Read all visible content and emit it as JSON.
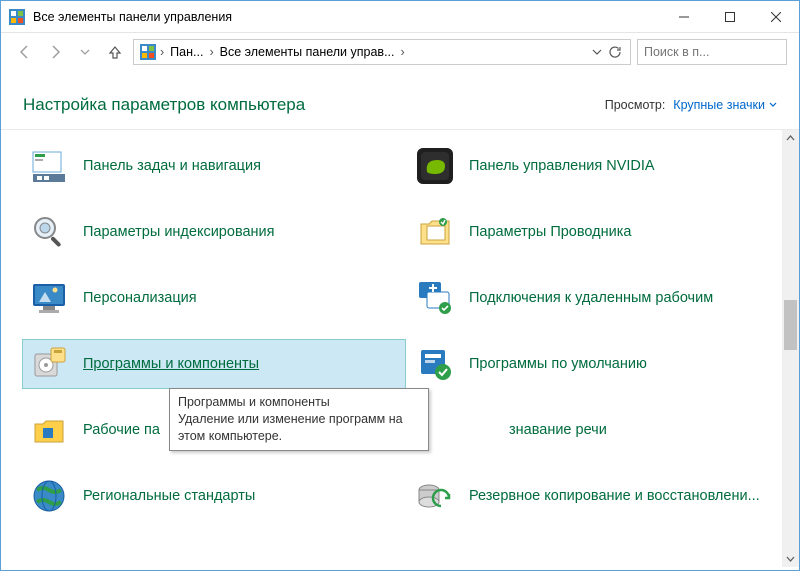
{
  "titlebar": {
    "title": "Все элементы панели управления"
  },
  "breadcrumb": {
    "seg1": "Пан...",
    "seg2": "Все элементы панели управ..."
  },
  "search": {
    "placeholder": "Поиск в п..."
  },
  "header": {
    "page_title": "Настройка параметров компьютера",
    "view_label": "Просмотр:",
    "view_value": "Крупные значки"
  },
  "items": [
    {
      "label": "Панель задач и навигация"
    },
    {
      "label": "Панель управления NVIDIA"
    },
    {
      "label": "Параметры индексирования"
    },
    {
      "label": "Параметры Проводника"
    },
    {
      "label": "Персонализация"
    },
    {
      "label": "Подключения к удаленным рабочим"
    },
    {
      "label": "Программы и компоненты"
    },
    {
      "label": "Программы по умолчанию"
    },
    {
      "label": "Рабочие па"
    },
    {
      "label": "знавание речи"
    },
    {
      "label": "Региональные стандарты"
    },
    {
      "label": "Резервное копирование и восстановлени..."
    }
  ],
  "tooltip": {
    "title": "Программы и компоненты",
    "body": "Удаление или изменение программ на этом компьютере."
  }
}
